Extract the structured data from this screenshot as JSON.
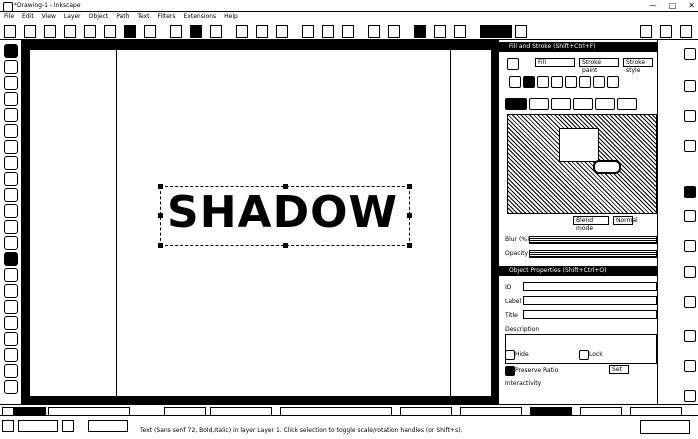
{
  "window": {
    "title": "*Drawing-1 - Inkscape",
    "buttons": [
      "—",
      "□",
      "✕"
    ]
  },
  "menu": [
    "File",
    "Edit",
    "View",
    "Layer",
    "Object",
    "Path",
    "Text",
    "Filters",
    "Extensions",
    "Help"
  ],
  "canvas": {
    "text": "SHADOW"
  },
  "fill_stroke": {
    "header": "Fill and Stroke (Shift+Ctrl+F)",
    "tabs": [
      "Fill",
      "Stroke paint",
      "Stroke style"
    ],
    "blur_label": "Blur (%)",
    "opacity_label": "Opacity (%)",
    "blend_label": "Blend mode",
    "blend_value": "Normal"
  },
  "object_props": {
    "header": "Object Properties (Shift+Ctrl+O)",
    "id_label": "ID",
    "label_label": "Label",
    "title_label": "Title",
    "description_label": "Description",
    "hide_label": "Hide",
    "lock_label": "Lock",
    "preserve_ratio_label": "Preserve Ratio",
    "set_button": "Set",
    "interactivity_label": "Interactivity"
  },
  "status": {
    "message": "Text (Sans serif 72, Bold,Italic) in layer Layer 1. Click selection to toggle scale/rotation handles (or Shift+s)."
  }
}
